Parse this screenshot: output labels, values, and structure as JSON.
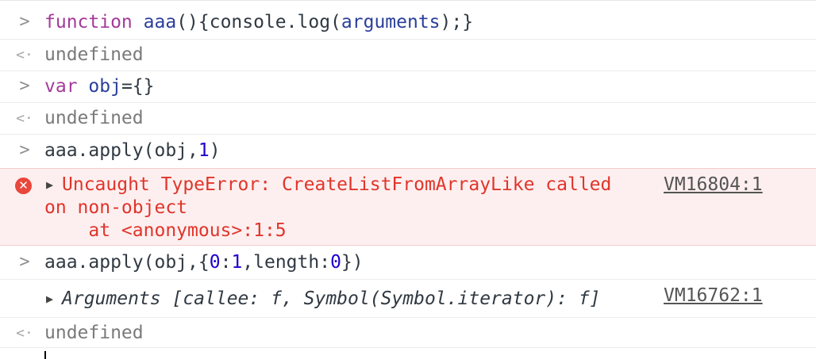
{
  "entries": [
    {
      "type": "input",
      "parts": [
        "function",
        " ",
        "aaa",
        "(){console.log(",
        "arguments",
        ");}"
      ]
    },
    {
      "type": "return",
      "text": "undefined"
    },
    {
      "type": "input",
      "parts": [
        "var",
        " ",
        "obj",
        "={}"
      ]
    },
    {
      "type": "return",
      "text": "undefined"
    },
    {
      "type": "input",
      "parts": [
        "aaa.apply(obj,",
        "1",
        ")"
      ]
    },
    {
      "type": "error",
      "lines": [
        "Uncaught TypeError: CreateListFromArrayLike called",
        "on non-object",
        "    at <anonymous>:1:5"
      ],
      "source": "VM16804:1"
    },
    {
      "type": "input",
      "parts": [
        "aaa.apply(obj,{",
        "0",
        ":",
        "1",
        ",length:",
        "0",
        "})"
      ]
    },
    {
      "type": "log",
      "text": "Arguments [callee: f, Symbol(Symbol.iterator): f]",
      "source": "VM16762:1"
    },
    {
      "type": "return",
      "text": "undefined"
    }
  ],
  "icons": {
    "prompt": "chevron-right-icon",
    "return": "return-arrow-icon",
    "error": "error-icon",
    "expand": "expand-triangle-icon"
  },
  "colors": {
    "keyword": "#a33a99",
    "definition": "#2a3f9a",
    "number": "#1c00cf",
    "error": "#e0352b",
    "error_bg": "#fdefef"
  }
}
